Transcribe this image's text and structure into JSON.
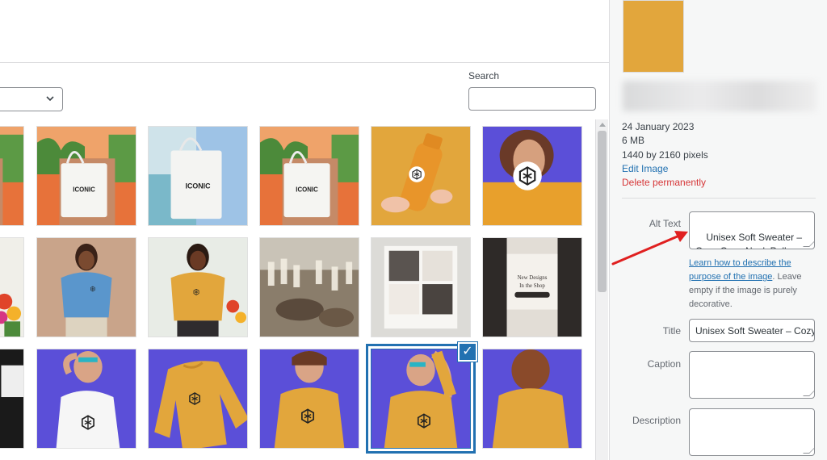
{
  "header": {
    "close_symbol": "×"
  },
  "toolbar": {
    "search_label": "Search",
    "search_value": ""
  },
  "grid": {
    "selected_index": 16,
    "check_symbol": "✓",
    "tiles": [
      {
        "kind": "tote",
        "label": ""
      },
      {
        "kind": "tote",
        "label": "ICONIC"
      },
      {
        "kind": "tote-blue",
        "label": "ICONIC"
      },
      {
        "kind": "tote",
        "label": "ICONIC"
      },
      {
        "kind": "bottle",
        "label": ""
      },
      {
        "kind": "purple-sticker",
        "label": ""
      },
      {
        "kind": "flowers",
        "label": ""
      },
      {
        "kind": "person-blue-tee",
        "label": ""
      },
      {
        "kind": "person-yellow-tee",
        "label": ""
      },
      {
        "kind": "drinks",
        "label": ""
      },
      {
        "kind": "mockup-grid",
        "label": ""
      },
      {
        "kind": "mockup-shop",
        "label": "New Designs In the Shop"
      },
      {
        "kind": "dark-person",
        "label": ""
      },
      {
        "kind": "white-sweater",
        "label": ""
      },
      {
        "kind": "flat-sweater",
        "label": ""
      },
      {
        "kind": "yellow-sweater",
        "label": ""
      },
      {
        "kind": "yellow-sweater-hand",
        "label": ""
      },
      {
        "kind": "back-sweater",
        "label": ""
      }
    ]
  },
  "details": {
    "date": "24 January 2023",
    "size": "6 MB",
    "dimensions": "1440 by 2160 pixels",
    "edit_link": "Edit Image",
    "delete_link": "Delete permanently"
  },
  "fields": {
    "alt_label": "Alt Text",
    "alt_value": "Unisex Soft Sweater – Cozy Crew Neck Pullover",
    "help_link": "Learn how to describe the purpose of the image",
    "help_text": ". Leave empty if the image is purely decorative.",
    "title_label": "Title",
    "title_value": "Unisex Soft Sweater – Cozy Crew Neck Pullover",
    "caption_label": "Caption",
    "caption_value": "",
    "description_label": "Description",
    "description_value": ""
  },
  "colors": {
    "accent": "#2271b1",
    "danger": "#d63638",
    "annotation": "#e02020",
    "purple": "#5b4fd8",
    "mustard": "#e2a63c"
  }
}
